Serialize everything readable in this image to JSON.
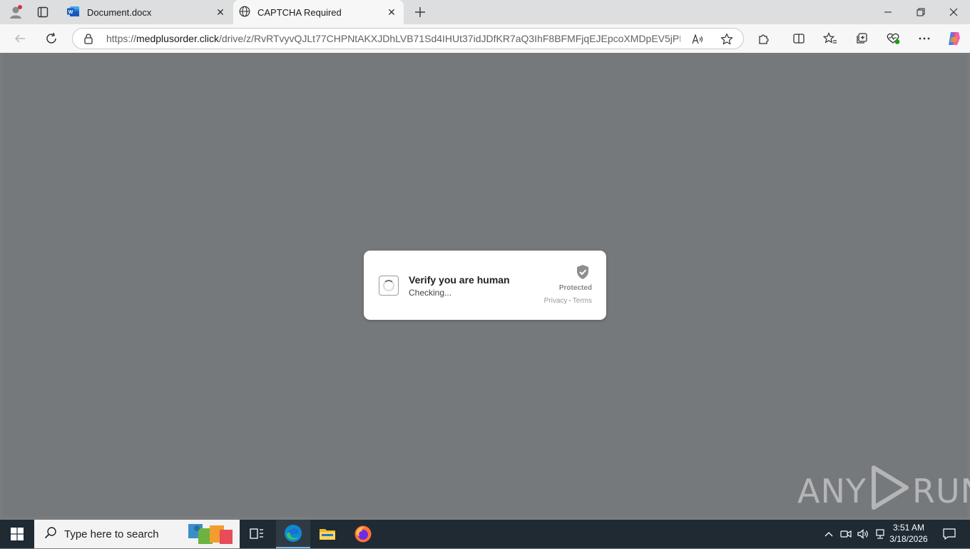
{
  "browser": {
    "tabs": [
      {
        "title": "Document.docx",
        "icon": "word-icon"
      },
      {
        "title": "CAPTCHA Required",
        "icon": "globe-icon",
        "active": true
      }
    ],
    "address": {
      "url_scheme": "https://",
      "url_host": "medplusorder.click",
      "url_path": "/drive/z/RvRTvyvQJLt77CHPNtAKXJDhLVB71Sd4IHUt37idJDfKR7aQ3IhF8BFMFjqEJEpcoXMDpEV5jPRN..."
    }
  },
  "captcha": {
    "title": "Verify you are human",
    "status": "Checking...",
    "protected_label": "Protected",
    "privacy_link": "Privacy",
    "separator": "-",
    "terms_link": "Terms"
  },
  "watermark": {
    "left": "ANY",
    "right": "RUN"
  },
  "taskbar": {
    "search_placeholder": "Type here to search",
    "time": "3:51 AM",
    "date": "3/18/2026"
  },
  "colors": {
    "page_background": "#76797c",
    "taskbar": "#1f2a33",
    "active_tab": "#f7f7f7",
    "tab_strip": "#dcdedf"
  }
}
